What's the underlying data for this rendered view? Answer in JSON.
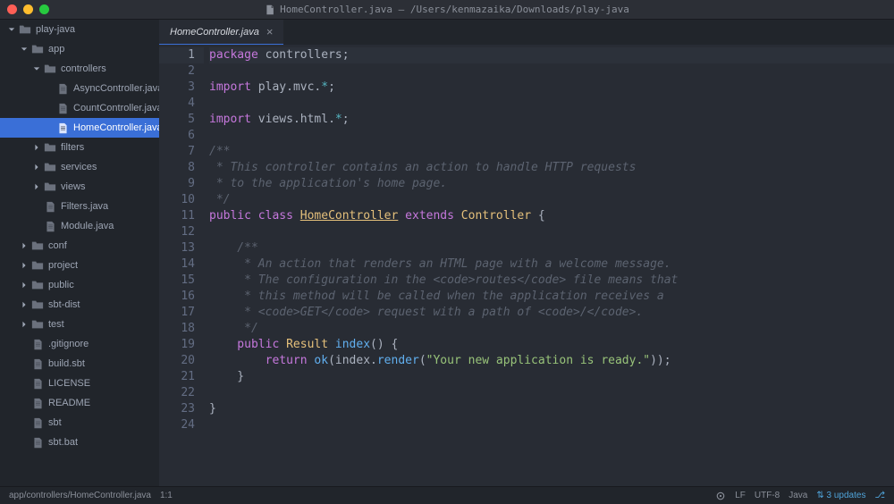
{
  "titlebar": {
    "filename": "HomeController.java",
    "path": "/Users/kenmazaika/Downloads/play-java"
  },
  "sidebar": {
    "items": [
      {
        "label": "play-java",
        "depth": 0,
        "type": "folder",
        "expanded": true
      },
      {
        "label": "app",
        "depth": 1,
        "type": "folder",
        "expanded": true
      },
      {
        "label": "controllers",
        "depth": 2,
        "type": "folder",
        "expanded": true
      },
      {
        "label": "AsyncController.java",
        "depth": 3,
        "type": "file"
      },
      {
        "label": "CountController.java",
        "depth": 3,
        "type": "file"
      },
      {
        "label": "HomeController.java",
        "depth": 3,
        "type": "file",
        "selected": true
      },
      {
        "label": "filters",
        "depth": 2,
        "type": "folder",
        "expanded": false
      },
      {
        "label": "services",
        "depth": 2,
        "type": "folder",
        "expanded": false
      },
      {
        "label": "views",
        "depth": 2,
        "type": "folder",
        "expanded": false
      },
      {
        "label": "Filters.java",
        "depth": 2,
        "type": "file"
      },
      {
        "label": "Module.java",
        "depth": 2,
        "type": "file"
      },
      {
        "label": "conf",
        "depth": 1,
        "type": "folder",
        "expanded": false
      },
      {
        "label": "project",
        "depth": 1,
        "type": "folder",
        "expanded": false
      },
      {
        "label": "public",
        "depth": 1,
        "type": "folder",
        "expanded": false
      },
      {
        "label": "sbt-dist",
        "depth": 1,
        "type": "folder",
        "expanded": false
      },
      {
        "label": "test",
        "depth": 1,
        "type": "folder",
        "expanded": false
      },
      {
        "label": ".gitignore",
        "depth": 1,
        "type": "file"
      },
      {
        "label": "build.sbt",
        "depth": 1,
        "type": "file"
      },
      {
        "label": "LICENSE",
        "depth": 1,
        "type": "file"
      },
      {
        "label": "README",
        "depth": 1,
        "type": "file"
      },
      {
        "label": "sbt",
        "depth": 1,
        "type": "file"
      },
      {
        "label": "sbt.bat",
        "depth": 1,
        "type": "file"
      }
    ]
  },
  "tabs": {
    "active": "HomeController.java"
  },
  "code": {
    "lines": [
      [
        {
          "t": "package ",
          "c": "kw"
        },
        {
          "t": "controllers",
          "c": "pkg"
        },
        {
          "t": ";",
          "c": "pun"
        }
      ],
      [],
      [
        {
          "t": "import ",
          "c": "kw"
        },
        {
          "t": "play",
          "c": "pkg"
        },
        {
          "t": ".",
          "c": "pun"
        },
        {
          "t": "mvc",
          "c": "pkg"
        },
        {
          "t": ".",
          "c": "pkg"
        },
        {
          "t": "*",
          "c": "op"
        },
        {
          "t": ";",
          "c": "pun"
        }
      ],
      [],
      [
        {
          "t": "import ",
          "c": "kw"
        },
        {
          "t": "views",
          "c": "pkg"
        },
        {
          "t": ".",
          "c": "pun"
        },
        {
          "t": "html",
          "c": "pkg"
        },
        {
          "t": ".",
          "c": "pkg"
        },
        {
          "t": "*",
          "c": "op"
        },
        {
          "t": ";",
          "c": "pun"
        }
      ],
      [],
      [
        {
          "t": "/**",
          "c": "cmt"
        }
      ],
      [
        {
          "t": " * This controller contains an action to handle HTTP requests",
          "c": "cmt"
        }
      ],
      [
        {
          "t": " * to the application's home page.",
          "c": "cmt"
        }
      ],
      [
        {
          "t": " */",
          "c": "cmt"
        }
      ],
      [
        {
          "t": "public ",
          "c": "kw"
        },
        {
          "t": "class ",
          "c": "kw"
        },
        {
          "t": "HomeController",
          "c": "cls-u"
        },
        {
          "t": " extends ",
          "c": "kw"
        },
        {
          "t": "Controller",
          "c": "cls"
        },
        {
          "t": " {",
          "c": "pun"
        }
      ],
      [],
      [
        {
          "t": "    /**",
          "c": "cmt"
        }
      ],
      [
        {
          "t": "     * An action that renders an HTML page with a welcome message.",
          "c": "cmt"
        }
      ],
      [
        {
          "t": "     * The configuration in the <code>routes</code> file means that",
          "c": "cmt"
        }
      ],
      [
        {
          "t": "     * this method will be called when the application receives a",
          "c": "cmt"
        }
      ],
      [
        {
          "t": "     * <code>GET</code> request with a path of <code>/</code>.",
          "c": "cmt"
        }
      ],
      [
        {
          "t": "     */",
          "c": "cmt"
        }
      ],
      [
        {
          "t": "    public ",
          "c": "kw"
        },
        {
          "t": "Result",
          "c": "cls"
        },
        {
          "t": " ",
          "c": ""
        },
        {
          "t": "index",
          "c": "fn"
        },
        {
          "t": "() {",
          "c": "pun"
        }
      ],
      [
        {
          "t": "        return ",
          "c": "kw"
        },
        {
          "t": "ok",
          "c": "fn"
        },
        {
          "t": "(index",
          "c": "pun"
        },
        {
          "t": ".",
          "c": "pun"
        },
        {
          "t": "render",
          "c": "fn"
        },
        {
          "t": "(",
          "c": "pun"
        },
        {
          "t": "\"Your new application is ready.\"",
          "c": "str"
        },
        {
          "t": "));",
          "c": "pun"
        }
      ],
      [
        {
          "t": "    }",
          "c": "pun"
        }
      ],
      [],
      [
        {
          "t": "}",
          "c": "pun"
        }
      ],
      []
    ],
    "currentLine": 1
  },
  "statusbar": {
    "path": "app/controllers/HomeController.java",
    "position": "1:1",
    "lineEnding": "LF",
    "encoding": "UTF-8",
    "language": "Java",
    "updates": "3 updates"
  }
}
